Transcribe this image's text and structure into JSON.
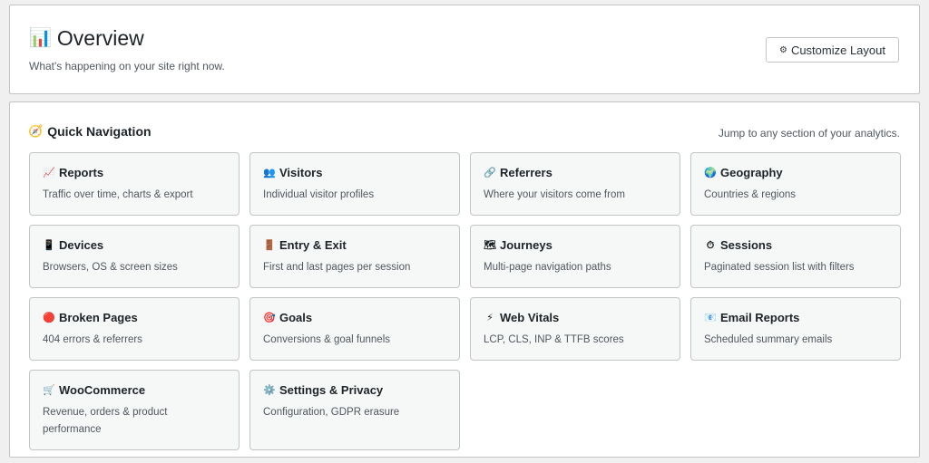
{
  "overview": {
    "icon": "📊",
    "icon_name": "bar-chart-icon",
    "title": "Overview",
    "subtitle": "What's happening on your site right now.",
    "customize_icon": "⚙",
    "customize_label": "Customize Layout"
  },
  "quick_nav": {
    "icon": "🧭",
    "icon_name": "compass-icon",
    "title": "Quick Navigation",
    "hint": "Jump to any section of your analytics."
  },
  "cards": [
    {
      "icon": "📈",
      "icon_name": "chart-up-icon",
      "title": "Reports",
      "desc": "Traffic over time, charts & export"
    },
    {
      "icon": "👥",
      "icon_name": "people-icon",
      "title": "Visitors",
      "desc": "Individual visitor profiles"
    },
    {
      "icon": "🔗",
      "icon_name": "link-icon",
      "title": "Referrers",
      "desc": "Where your visitors come from"
    },
    {
      "icon": "🌍",
      "icon_name": "globe-icon",
      "title": "Geography",
      "desc": "Countries & regions"
    },
    {
      "icon": "📱",
      "icon_name": "phone-icon",
      "title": "Devices",
      "desc": "Browsers, OS & screen sizes"
    },
    {
      "icon": "🚪",
      "icon_name": "door-icon",
      "title": "Entry & Exit",
      "desc": "First and last pages per session"
    },
    {
      "icon": "🗺",
      "icon_name": "map-icon",
      "title": "Journeys",
      "desc": "Multi-page navigation paths"
    },
    {
      "icon": "⏱",
      "icon_name": "stopwatch-icon",
      "title": "Sessions",
      "desc": "Paginated session list with filters"
    },
    {
      "icon": "🔴",
      "icon_name": "red-circle-icon",
      "title": "Broken Pages",
      "desc": "404 errors & referrers"
    },
    {
      "icon": "🎯",
      "icon_name": "target-icon",
      "title": "Goals",
      "desc": "Conversions & goal funnels"
    },
    {
      "icon": "⚡",
      "icon_name": "lightning-icon",
      "title": "Web Vitals",
      "desc": "LCP, CLS, INP & TTFB scores"
    },
    {
      "icon": "📧",
      "icon_name": "email-icon",
      "title": "Email Reports",
      "desc": "Scheduled summary emails"
    },
    {
      "icon": "🛒",
      "icon_name": "cart-icon",
      "title": "WooCommerce",
      "desc": "Revenue, orders & product performance"
    },
    {
      "icon": "⚙️",
      "icon_name": "gear-icon",
      "title": "Settings & Privacy",
      "desc": "Configuration, GDPR erasure"
    }
  ]
}
